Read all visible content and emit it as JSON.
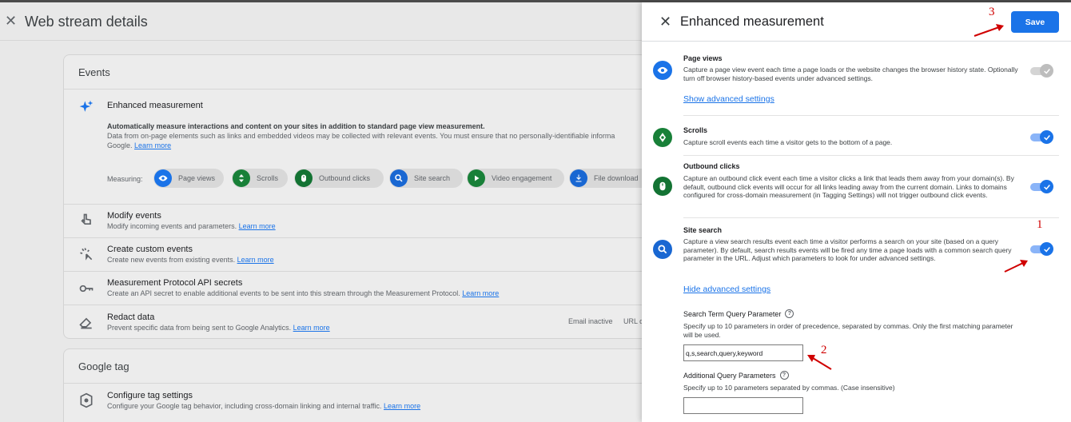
{
  "background": {
    "title": "Web stream details",
    "events_card": {
      "title": "Events",
      "enhanced": {
        "title": "Enhanced measurement",
        "desc_line1": "Automatically measure interactions and content on your sites in addition to standard page view measurement.",
        "desc_line2": "Data from on-page elements such as links and embedded videos may be collected with relevant events. You must ensure that no personally-identifiable informa",
        "desc_line3_prefix": "Google.",
        "learn_more": "Learn more",
        "measuring_label": "Measuring:",
        "chips": [
          {
            "label": "Page views",
            "icon": "eye-icon",
            "color": "#1a73e8"
          },
          {
            "label": "Scrolls",
            "icon": "scroll-icon",
            "color": "#188038"
          },
          {
            "label": "Outbound clicks",
            "icon": "mouse-icon",
            "color": "#137333"
          },
          {
            "label": "Site search",
            "icon": "search-icon",
            "color": "#1967d2"
          },
          {
            "label": "Video engagement",
            "icon": "play-icon",
            "color": "#188038"
          },
          {
            "label": "File download",
            "icon": "download-icon",
            "color": "#1967d2"
          }
        ]
      },
      "rows": [
        {
          "title": "Modify events",
          "desc": "Modify incoming events and parameters.",
          "link": "Learn more"
        },
        {
          "title": "Create custom events",
          "desc": "Create new events from existing events.",
          "link": "Learn more"
        },
        {
          "title": "Measurement Protocol API secrets",
          "desc": "Create an API secret to enable additional events to be sent into this stream through the Measurement Protocol.",
          "link": "Learn more"
        },
        {
          "title": "Redact data",
          "desc": "Prevent specific data from being sent to Google Analytics.",
          "link": "Learn more",
          "status1": "Email inactive",
          "status2": "URL q"
        }
      ]
    },
    "gtag_card": {
      "title": "Google tag",
      "row": {
        "title": "Configure tag settings",
        "desc": "Configure your Google tag behavior, including cross-domain linking and internal traffic.",
        "link": "Learn more"
      }
    }
  },
  "panel": {
    "title": "Enhanced measurement",
    "save_label": "Save",
    "sections": {
      "page_views": {
        "title": "Page views",
        "desc": "Capture a page view event each time a page loads or the website changes the browser history state. Optionally turn off browser history-based events under advanced settings.",
        "link": "Show advanced settings",
        "enabled": true,
        "toggle_disabled": true
      },
      "scrolls": {
        "title": "Scrolls",
        "desc": "Capture scroll events each time a visitor gets to the bottom of a page.",
        "enabled": true
      },
      "outbound": {
        "title": "Outbound clicks",
        "desc": "Capture an outbound click event each time a visitor clicks a link that leads them away from your domain(s). By default, outbound click events will occur for all links leading away from the current domain. Links to domains configured for cross-domain measurement (in Tagging Settings) will not trigger outbound click events.",
        "enabled": true
      },
      "site_search": {
        "title": "Site search",
        "desc": "Capture a view search results event each time a visitor performs a search on your site (based on a query parameter). By default, search results events will be fired any time a page loads with a common search query parameter in the URL. Adjust which parameters to look for under advanced settings.",
        "link": "Hide advanced settings",
        "enabled": true,
        "search_term_label": "Search Term Query Parameter",
        "search_term_desc": "Specify up to 10 parameters in order of precedence, separated by commas. Only the first matching parameter will be used.",
        "search_term_value": "q,s,search,query,keyword",
        "additional_label": "Additional Query Parameters",
        "additional_desc": "Specify up to 10 parameters separated by commas. (Case insensitive)",
        "additional_value": ""
      }
    },
    "help_glyph": "?"
  },
  "annotations": {
    "one": "1",
    "two": "2",
    "three": "3",
    "color": "#d00000"
  }
}
